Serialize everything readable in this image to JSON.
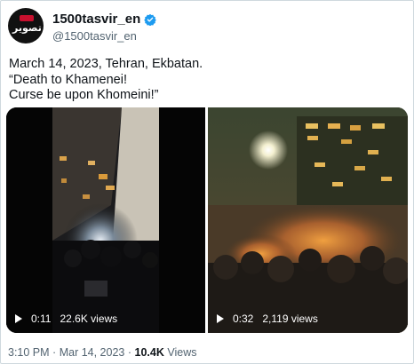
{
  "account": {
    "display_name": "1500tasvir_en",
    "handle": "@1500tasvir_en",
    "avatar_text": "تصویر",
    "verified_color": "#1d9bf0"
  },
  "tweet": {
    "lines": [
      "March 14, 2023, Tehran, Ekbatan.",
      "“Death to Khamenei!",
      "Curse be upon Khomeini!”"
    ]
  },
  "videos": [
    {
      "duration": "0:11",
      "views": "22.6K views"
    },
    {
      "duration": "0:32",
      "views": "2,119 views"
    }
  ],
  "footer": {
    "time": "3:10 PM",
    "separator": "·",
    "date": "Mar 14, 2023",
    "view_count": "10.4K",
    "views_label": "Views"
  }
}
